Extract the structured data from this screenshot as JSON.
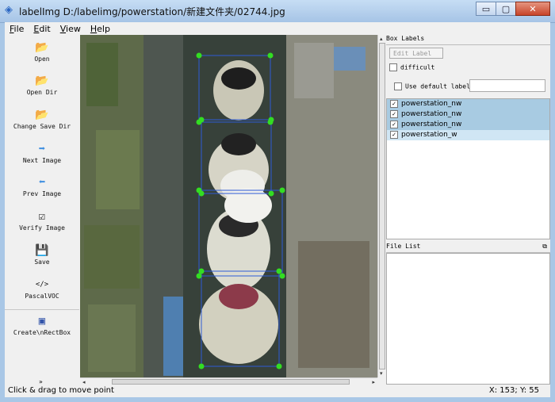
{
  "window": {
    "title": "labelImg D:/labelimg/powerstation/新建文件夹/02744.jpg",
    "icon": "tag-icon",
    "buttons": {
      "minimize": "▭",
      "maximize": "▢",
      "close": "✕"
    }
  },
  "menu": [
    "File",
    "Edit",
    "View",
    "Help"
  ],
  "toolbar": [
    {
      "label": "Open",
      "icon": "folder-icon",
      "glyph": "📂"
    },
    {
      "label": "Open Dir",
      "icon": "folder-icon",
      "glyph": "📂"
    },
    {
      "label": "Change Save Dir",
      "icon": "folder-icon",
      "glyph": "📂"
    },
    {
      "label": "Next Image",
      "icon": "arrow-right-icon",
      "glyph": "➡"
    },
    {
      "label": "Prev Image",
      "icon": "arrow-left-icon",
      "glyph": "⬅"
    },
    {
      "label": "Verify Image",
      "icon": "checkbox-icon",
      "glyph": "☑"
    },
    {
      "label": "Save",
      "icon": "floppy-icon",
      "glyph": "💾"
    },
    {
      "label": "PascalVOC",
      "icon": "code-icon",
      "glyph": "</>"
    },
    {
      "label": "Create\\nRectBox",
      "icon": "rectbox-icon",
      "glyph": "▣"
    }
  ],
  "toolbar_more": "»",
  "box_labels": {
    "title": "Box Labels",
    "edit_label": "Edit Label",
    "difficult": "difficult",
    "use_default": "Use default label",
    "default_value": "",
    "items": [
      {
        "text": "powerstation_nw",
        "checked": true,
        "state": "selected"
      },
      {
        "text": "powerstation_nw",
        "checked": true,
        "state": "selected"
      },
      {
        "text": "powerstation_nw",
        "checked": true,
        "state": "selected"
      },
      {
        "text": "powerstation_w",
        "checked": true,
        "state": "highlight"
      }
    ]
  },
  "file_list": {
    "title": "File List",
    "items": []
  },
  "status": {
    "message": "Click & drag to move point",
    "coords": "X: 153; Y: 55"
  },
  "colors": {
    "box": "#2e5bd6",
    "point": "#33dd22",
    "selection": "#a8cbe2"
  }
}
